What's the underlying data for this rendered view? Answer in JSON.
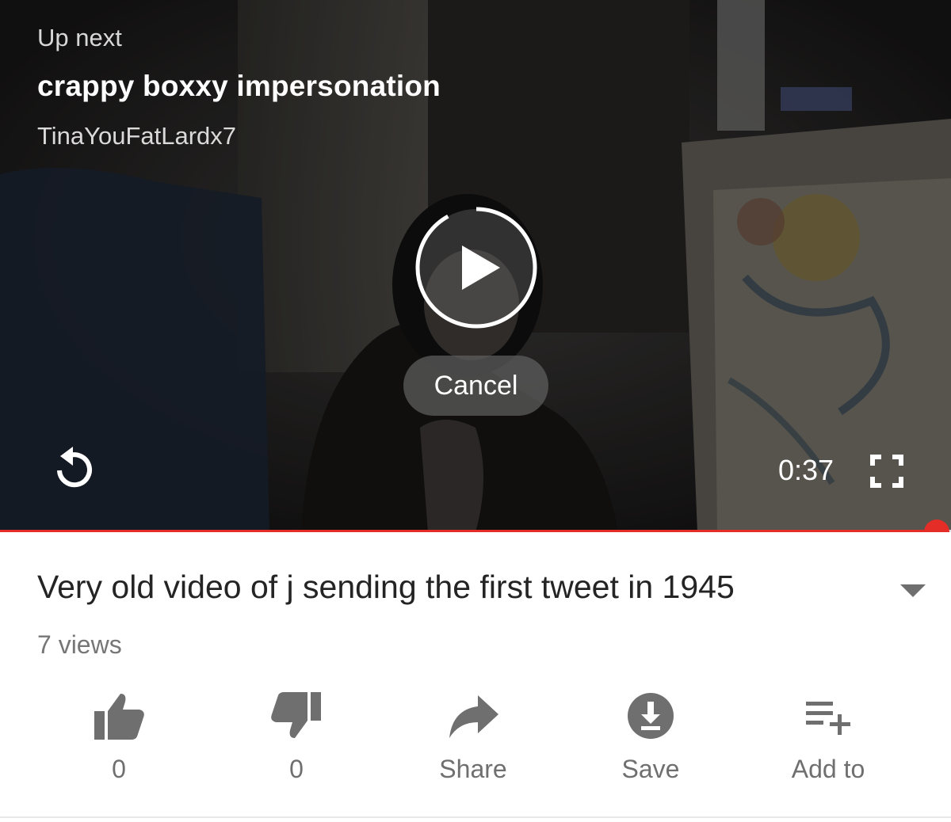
{
  "player": {
    "up_next_label": "Up next",
    "up_next_title": "crappy boxxy impersonation",
    "up_next_channel": "TinaYouFatLardx7",
    "cancel_label": "Cancel",
    "time": "0:37",
    "autoplay_countdown_fraction": 0.92,
    "progress_fraction": 0.985,
    "play_icon": "play-icon",
    "replay_icon": "replay-icon",
    "fullscreen_icon": "fullscreen-icon"
  },
  "video": {
    "title": "Very old video of j sending the first tweet in 1945",
    "views": "7 views",
    "expand_icon": "chevron-down-icon"
  },
  "actions": [
    {
      "icon": "thumbs-up-icon",
      "label": "0"
    },
    {
      "icon": "thumbs-down-icon",
      "label": "0"
    },
    {
      "icon": "share-icon",
      "label": "Share"
    },
    {
      "icon": "download-icon",
      "label": "Save"
    },
    {
      "icon": "add-to-playlist-icon",
      "label": "Add to"
    }
  ],
  "colors": {
    "accent": "#e52d27",
    "action_gray": "#6f6f6f",
    "title_text": "#242424"
  }
}
